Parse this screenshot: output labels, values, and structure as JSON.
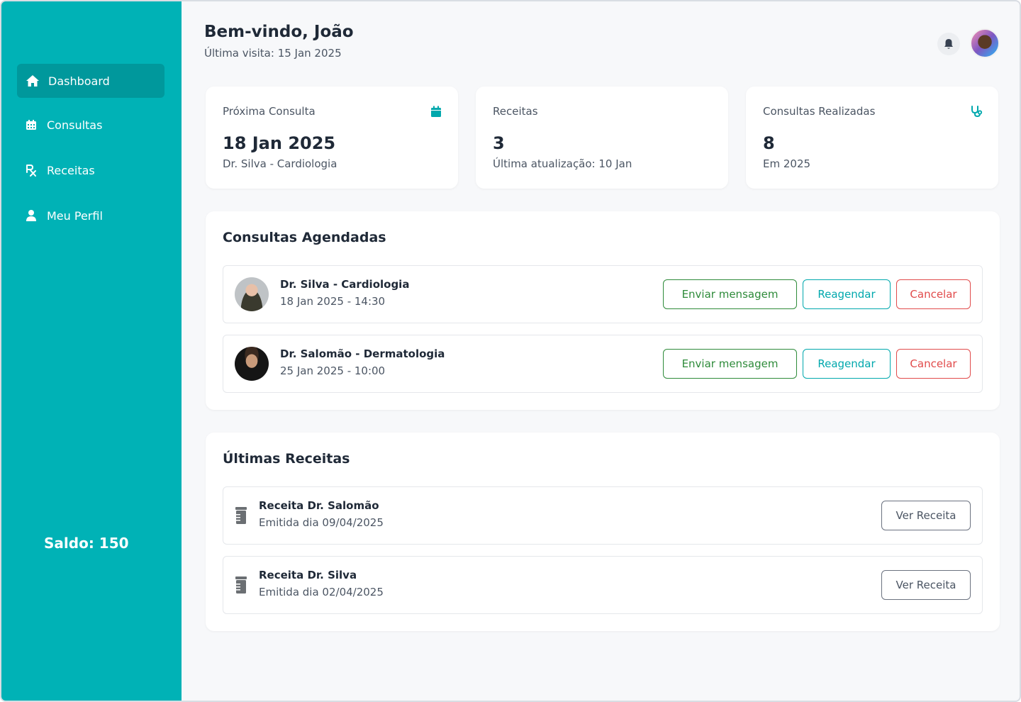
{
  "sidebar": {
    "items": [
      {
        "label": "Dashboard",
        "icon": "home-icon",
        "active": true
      },
      {
        "label": "Consultas",
        "icon": "calendar-icon",
        "active": false
      },
      {
        "label": "Receitas",
        "icon": "prescription-icon",
        "active": false
      },
      {
        "label": "Meu Perfil",
        "icon": "user-icon",
        "active": false
      }
    ],
    "saldo": "Saldo: 150"
  },
  "header": {
    "greeting": "Bem-vindo, João",
    "last_visit": "Última visita: 15 Jan 2025"
  },
  "stats": [
    {
      "label": "Próxima Consulta",
      "value": "18 Jan 2025",
      "sub": "Dr. Silva - Cardiologia",
      "icon": "calendar-icon"
    },
    {
      "label": "Receitas",
      "value": "3",
      "sub": "Última atualização: 10 Jan",
      "icon": ""
    },
    {
      "label": "Consultas Realizadas",
      "value": "8",
      "sub": "Em 2025",
      "icon": "stethoscope-icon"
    }
  ],
  "appointments": {
    "title": "Consultas Agendadas",
    "items": [
      {
        "doctor": "Dr. Silva - Cardiologia",
        "datetime": "18 Jan 2025 - 14:30"
      },
      {
        "doctor": "Dr. Salomão - Dermatologia",
        "datetime": "25 Jan 2025 - 10:00"
      }
    ],
    "message_label": "Enviar mensagem",
    "reschedule_label": "Reagendar",
    "cancel_label": "Cancelar"
  },
  "prescriptions": {
    "title": "Últimas Receitas",
    "items": [
      {
        "title": "Receita Dr. Salomão",
        "issued": "Emitida dia 09/04/2025"
      },
      {
        "title": "Receita Dr. Silva",
        "issued": "Emitida dia 02/04/2025"
      }
    ],
    "view_label": "Ver Receita"
  },
  "colors": {
    "sidebar": "#00b2b6",
    "sidebar_active": "#00989c",
    "accent": "#00a8ad",
    "message": "#2e8b3a",
    "cancel": "#e14b4b"
  }
}
